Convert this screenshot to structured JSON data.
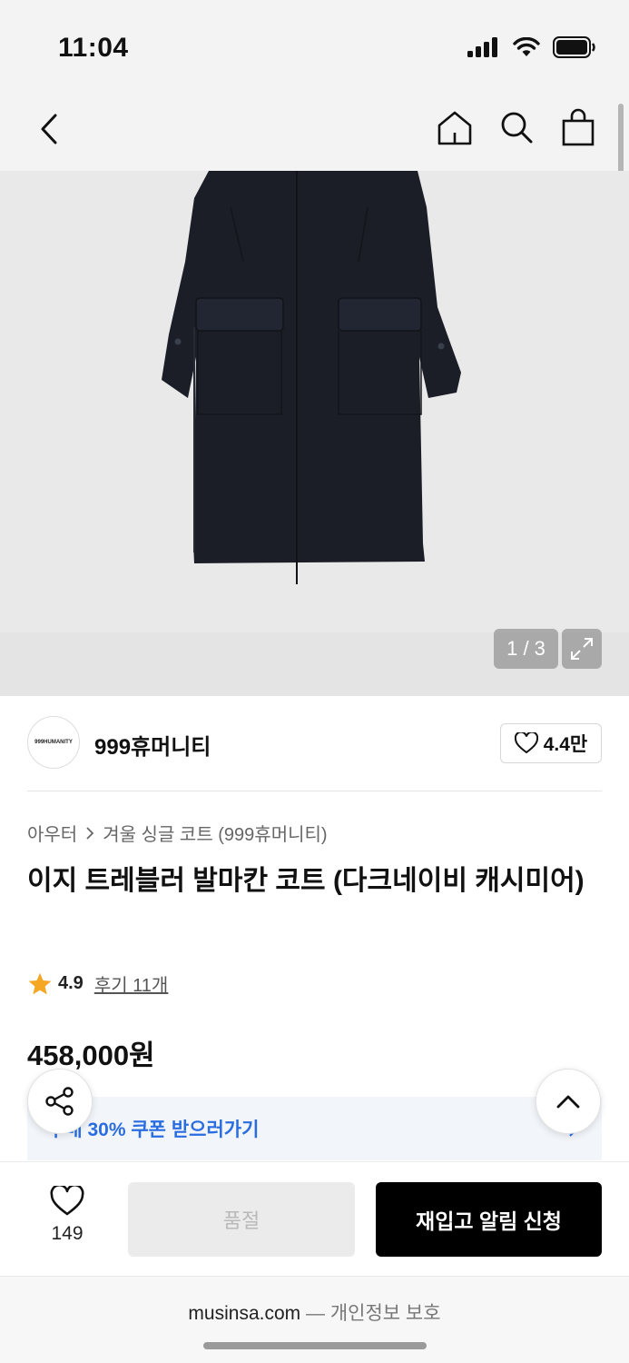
{
  "status": {
    "time": "11:04"
  },
  "header": {
    "icons": [
      "back-icon",
      "home-icon",
      "search-icon",
      "shopping-bag-icon"
    ]
  },
  "gallery": {
    "counter": "1 / 3"
  },
  "brand": {
    "logo_text": "999HUMANITY",
    "name": "999휴머니티",
    "likes": "4.4만"
  },
  "breadcrumb": {
    "parent": "아우터",
    "child": "겨울 싱글 코트 (999휴머니티)"
  },
  "product": {
    "title": "이지 트레블러 발마칸 코트 (다크네이비 캐시미어)",
    "rating": "4.9",
    "reviews": "후기 11개",
    "price": "458,000원"
  },
  "coupon": {
    "text": "구매 30% 쿠폰 받으러가기"
  },
  "actions": {
    "wish_count": "149",
    "soldout_label": "품절",
    "restock_label": "재입고 알림 신청"
  },
  "footer": {
    "domain": "musinsa.com",
    "separator": "—",
    "privacy": "개인정보 보호"
  },
  "colors": {
    "accent_blue": "#2a6de1",
    "star": "#f5a623",
    "primary_button": "#000000",
    "coat": "#1b1e27"
  }
}
